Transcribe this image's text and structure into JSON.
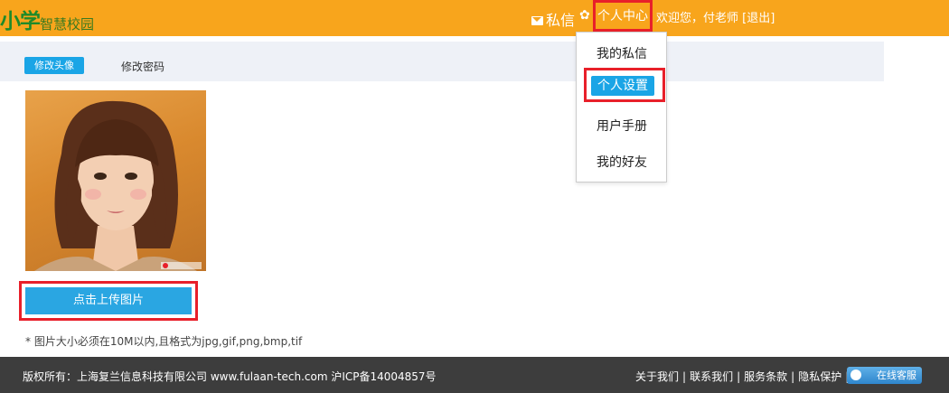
{
  "header": {
    "logo_main": "小学",
    "logo_sub": "智慧校园",
    "messages_label": "私信",
    "personal_center_label": "个人中心",
    "welcome_text": "欢迎您，付老师",
    "logout_label": "[退出]"
  },
  "tabs": {
    "active_label": "修改头像",
    "password_label": "修改密码"
  },
  "dropdown": {
    "items": [
      "我的私信",
      "个人设置",
      "用户手册",
      "我的好友"
    ],
    "selected_index": 1
  },
  "upload": {
    "button_label": "点击上传图片",
    "hint": "* 图片大小必须在10M以内,且格式为jpg,gif,png,bmp,tif"
  },
  "footer": {
    "copyright": "版权所有：上海复兰信息科技有限公司 www.fulaan-tech.com 沪ICP备14004857号",
    "links": [
      "关于我们",
      "联系我们",
      "服务条款",
      "隐私保护"
    ],
    "service_label": "在线客服"
  },
  "colors": {
    "topbar": "#f8a51c",
    "accent_blue": "#1aa5e6",
    "highlight_red": "#e8202a",
    "footer": "#3d3d3d"
  }
}
